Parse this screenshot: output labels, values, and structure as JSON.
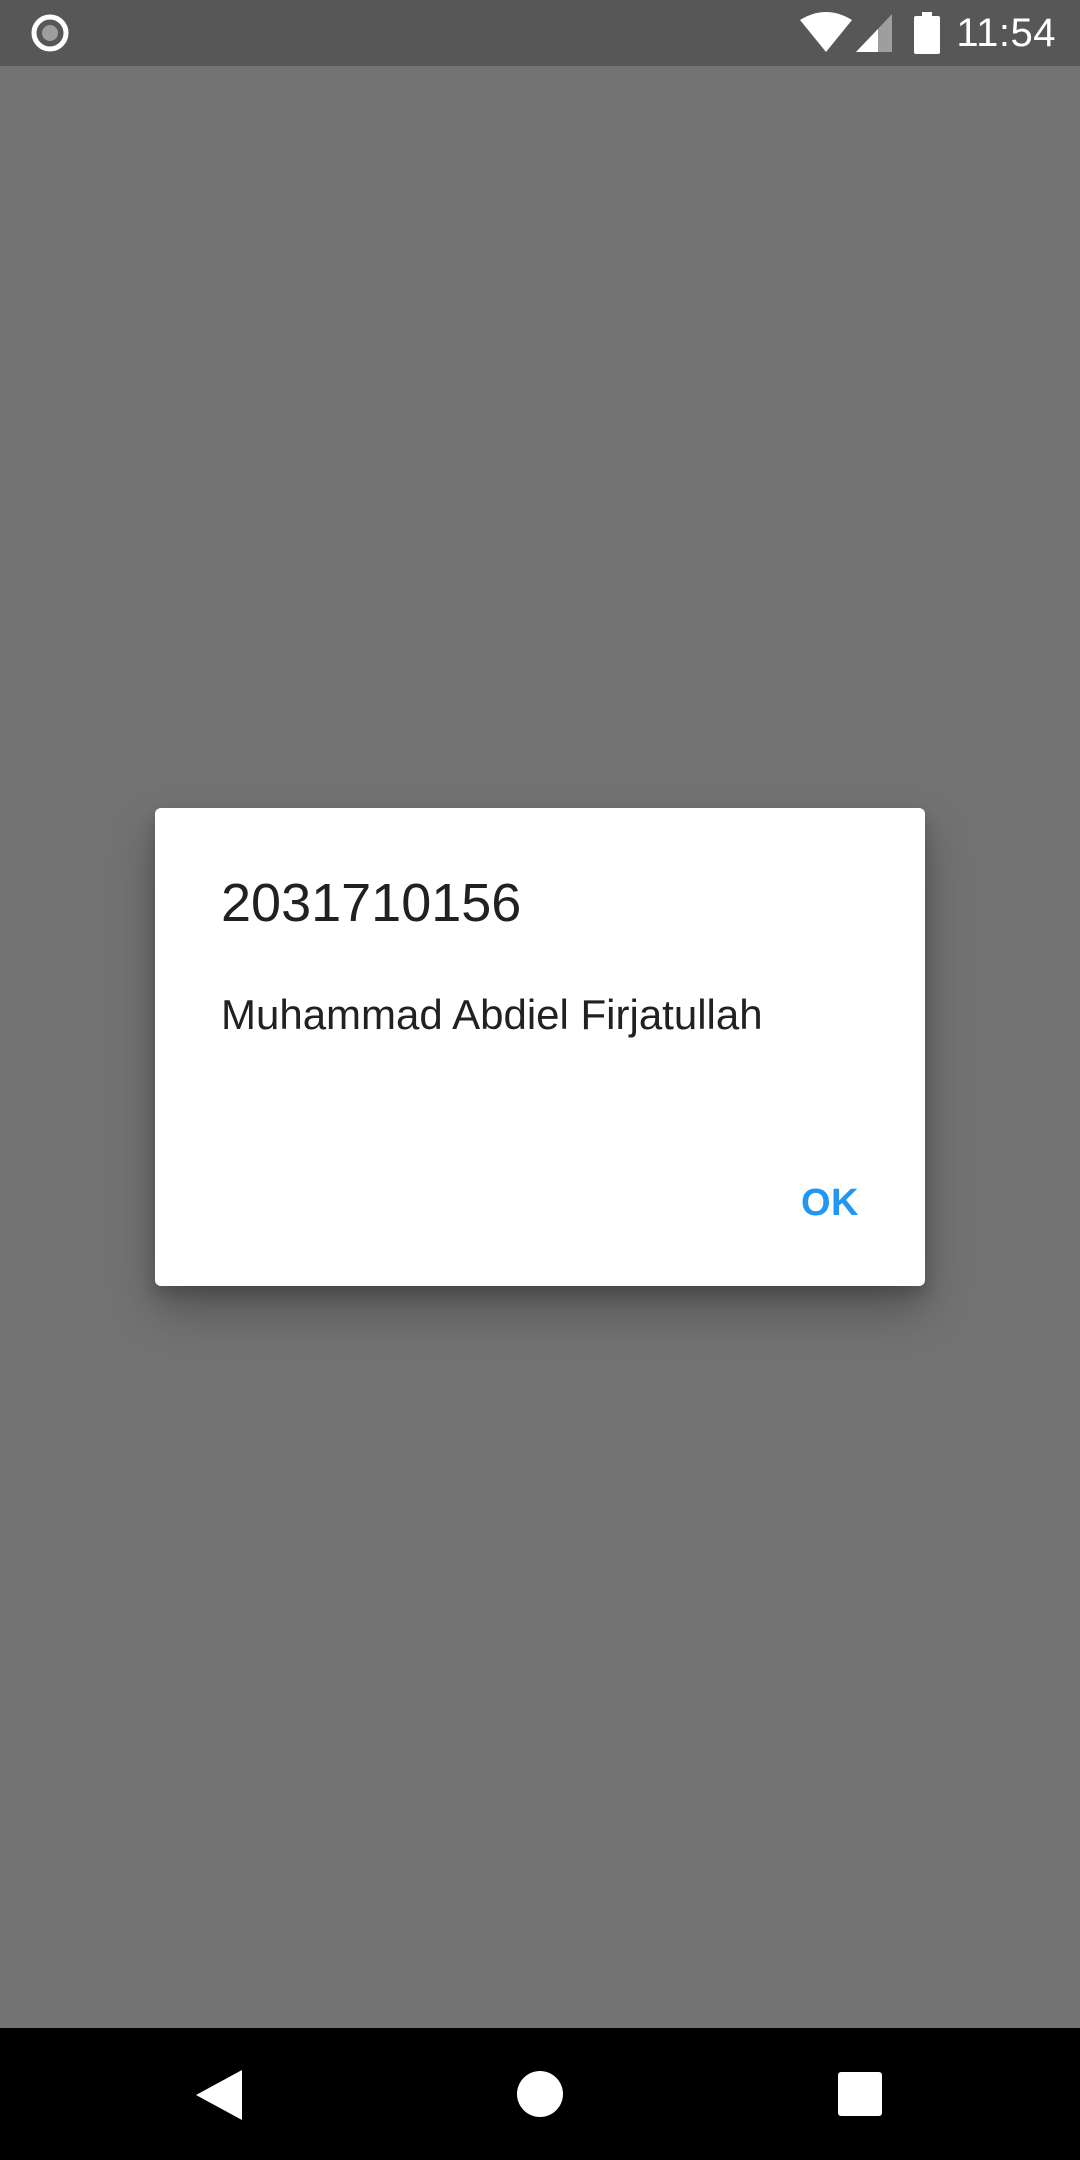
{
  "status_bar": {
    "time": "11:54",
    "left_icon": "record-circle-icon",
    "icons": [
      "wifi-icon",
      "cell-signal-icon",
      "battery-icon"
    ]
  },
  "dialog": {
    "title": "2031710156",
    "message": "Muhammad Abdiel Firjatullah",
    "ok_label": "OK"
  },
  "nav_bar": {
    "icons": [
      "back-icon",
      "home-icon",
      "recents-icon"
    ]
  },
  "colors": {
    "scrim": "#737373",
    "status_bar": "#575757",
    "accent": "#2196f3",
    "dialog_text": "#212121",
    "nav_bar": "#000000"
  }
}
